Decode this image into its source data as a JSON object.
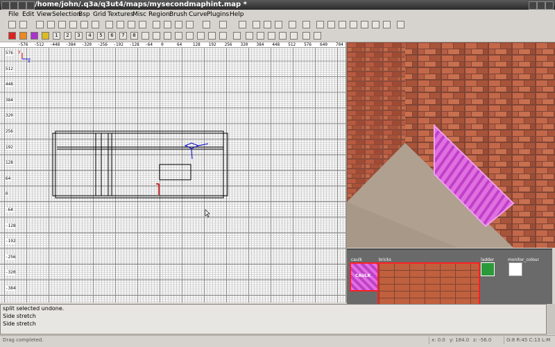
{
  "window": {
    "title": "/home/john/.q3a/q3ut4/maps/mysecondmaphint.map *"
  },
  "menu": [
    "File",
    "Edit",
    "View",
    "Selection",
    "Bsp",
    "Grid",
    "Textures",
    "Misc",
    "Region",
    "Brush",
    "Curve",
    "Plugins",
    "Help"
  ],
  "toolbar1_icons": [
    "open-icon",
    "save-icon",
    "flip-x-icon",
    "flip-y-icon",
    "flip-z-icon",
    "rotate-x-icon",
    "rotate-y-icon",
    "rotate-z-icon",
    "select-complete-tall-icon",
    "select-touching-icon",
    "select-partial-tall-icon",
    "select-inside-icon",
    "csg-subtract-icon",
    "csg-merge-icon",
    "hollow-icon",
    "clipper-icon",
    "change-view-icon",
    "texture-view-icon",
    "camera-icon",
    "x-view-icon",
    "y-view-icon",
    "z-view-icon",
    "free-rotate-icon",
    "free-scale-icon",
    "scale-x-icon",
    "scale-y-icon",
    "scale-z-icon",
    "texture-lock-icon",
    "texture-rotate-lock-icon",
    "bend-icon",
    "drag-edges-icon",
    "preferences-icon"
  ],
  "toolbar2_icons": [
    "brush-red-icon",
    "brush-orange-icon",
    "brush-purple-icon",
    "brush-yellow-icon",
    "brush-1-icon",
    "brush-2-icon",
    "brush-3-icon",
    "brush-4-icon",
    "brush-5-icon",
    "brush-6-icon",
    "brush-7-icon",
    "brush-8-icon",
    "patch-icon",
    "cylinder-icon",
    "sphere-icon",
    "bevel-icon",
    "endcap-icon",
    "cap-icon",
    "invert-cap-icon",
    "thicken-icon",
    "matrix-insert-icon",
    "matrix-delete-icon",
    "dropdown-icon",
    "redisperse-icon",
    "split-icon",
    "weld-icon",
    "snap-icon",
    "patch-tab-icon"
  ],
  "brush_numbers": [
    "1",
    "2",
    "3",
    "4",
    "5",
    "6",
    "7",
    "8"
  ],
  "grid": {
    "x_ticks": [
      "-576",
      "-512",
      "-448",
      "-384",
      "-320",
      "-256",
      "-192",
      "-128",
      "-64",
      "0",
      "64",
      "128",
      "192",
      "256",
      "320",
      "384",
      "448",
      "512",
      "576",
      "640",
      "704"
    ],
    "y_ticks": [
      "576",
      "512",
      "448",
      "384",
      "320",
      "256",
      "192",
      "128",
      "64",
      "0",
      "-64",
      "-128",
      "-192",
      "-256",
      "-320",
      "-384"
    ],
    "axis_label_x": "x",
    "axis_label_y": "y"
  },
  "textures": [
    {
      "name": "caulk",
      "selected": true
    },
    {
      "name": "bricks",
      "selected": true
    },
    {
      "name": "ladder",
      "selected": false
    },
    {
      "name": "monitor_colour",
      "selected": false
    }
  ],
  "caulk_label": "CAULK",
  "console": {
    "lines": [
      "split selected undone.",
      "Side stretch",
      "Side stretch"
    ]
  },
  "status": {
    "message": "Drag completed.",
    "coords": {
      "x": "x: 0.0",
      "y": "y: 184.0",
      "z": "z: -56.0"
    },
    "grid_info": "G:8  R:45  C:13  L:M"
  },
  "colors": {
    "grid_major": "#8a8a8a",
    "grid_minor": "#cfcfcf",
    "brush_outline": "#000000",
    "entity_blue": "#0000cc",
    "selection_magenta": "#e040e0",
    "texture_highlight": "#ff2020"
  }
}
